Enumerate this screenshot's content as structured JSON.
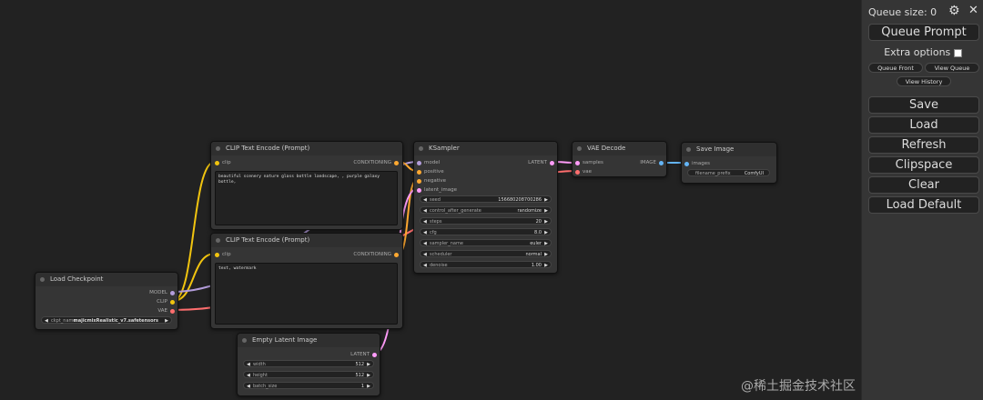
{
  "panel": {
    "queue_size": "Queue size: 0",
    "gear_icon": "gear",
    "close_icon": "close",
    "queue_prompt": "Queue Prompt",
    "extra_options": "Extra options",
    "queue_front": "Queue Front",
    "view_queue": "View Queue",
    "view_history": "View History",
    "save": "Save",
    "load": "Load",
    "refresh": "Refresh",
    "clipspace": "Clipspace",
    "clear": "Clear",
    "load_default": "Load Default"
  },
  "nodes": {
    "clip_pos": {
      "title": "CLIP Text Encode (Prompt)",
      "in_clip": "clip",
      "out_cond": "CONDITIONING",
      "text": "beautiful scenery nature glass bottle landscape, , purple galaxy bottle,"
    },
    "clip_neg": {
      "title": "CLIP Text Encode (Prompt)",
      "in_clip": "clip",
      "out_cond": "CONDITIONING",
      "text": "text, watermark"
    },
    "ksampler": {
      "title": "KSampler",
      "in_model": "model",
      "in_positive": "positive",
      "in_negative": "negative",
      "in_latent": "latent_image",
      "out_latent": "LATENT",
      "widgets": [
        {
          "label": "seed",
          "value": "156680208700286"
        },
        {
          "label": "control_after_generate",
          "value": "randomize"
        },
        {
          "label": "steps",
          "value": "20"
        },
        {
          "label": "cfg",
          "value": "8.0"
        },
        {
          "label": "sampler_name",
          "value": "euler"
        },
        {
          "label": "scheduler",
          "value": "normal"
        },
        {
          "label": "denoise",
          "value": "1.00"
        }
      ]
    },
    "vae_decode": {
      "title": "VAE Decode",
      "in_samples": "samples",
      "in_vae": "vae",
      "out_image": "IMAGE"
    },
    "save_image": {
      "title": "Save Image",
      "in_images": "images",
      "prefix_label": "filename_prefix",
      "prefix_value": "ComfyUI"
    },
    "load_checkpoint": {
      "title": "Load Checkpoint",
      "out_model": "MODEL",
      "out_clip": "CLIP",
      "out_vae": "VAE",
      "ckpt_label": "ckpt_name",
      "ckpt_value": "majicmixRealistic_v7.safetensors"
    },
    "empty_latent": {
      "title": "Empty Latent Image",
      "out_latent": "LATENT",
      "widgets": [
        {
          "label": "width",
          "value": "512"
        },
        {
          "label": "height",
          "value": "512"
        },
        {
          "label": "batch_size",
          "value": "1"
        }
      ]
    }
  },
  "colors": {
    "clip": "#f1c40f",
    "conditioning": "#ffa931",
    "model": "#b39ddb",
    "vae": "#ff6e6e",
    "latent": "#ff9cf9",
    "image": "#64b5f6"
  },
  "watermark": "@稀土掘金技术社区"
}
